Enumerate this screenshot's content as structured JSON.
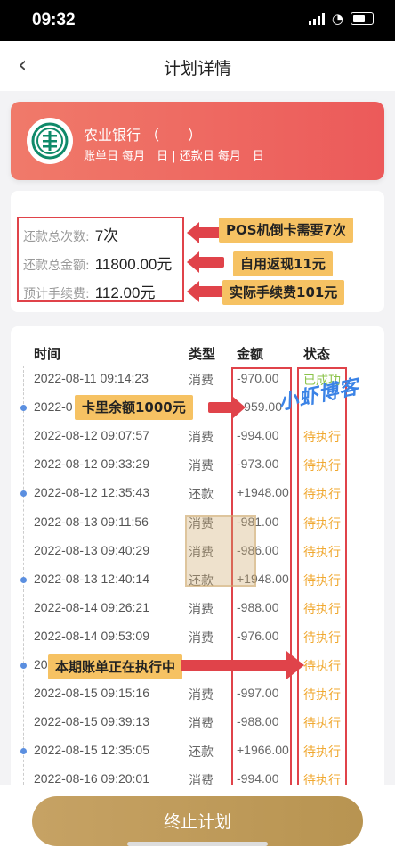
{
  "status_bar": {
    "time": "09:32"
  },
  "nav": {
    "title": "计划详情"
  },
  "bank": {
    "name": "农业银行 （　　）",
    "dates": "账单日 每月　日 | 还款日 每月　日"
  },
  "summary": {
    "total_count_label": "还款总次数:",
    "total_count": "7次",
    "total_amount_label": "还款总金额:",
    "total_amount": "11800.00元",
    "fee_label": "预计手续费:",
    "fee": "112.00元"
  },
  "callouts": {
    "c1": "POS机倒卡需要7次",
    "c2": "自用返现11元",
    "c3": "实际手续费101元",
    "c4": "卡里余额1000元",
    "c5": "本期账单正在执行中"
  },
  "watermark": "小虾博客",
  "list": {
    "headers": {
      "time": "时间",
      "type": "类型",
      "amount": "金额",
      "status": "状态"
    },
    "rows": [
      {
        "time": "2022-08-11 09:14:23",
        "type": "消费",
        "amount": "-970.00",
        "status": "已成功"
      },
      {
        "time": "2022-0",
        "type": "",
        "amount": "+959.00",
        "status": ""
      },
      {
        "time": "2022-08-12 09:07:57",
        "type": "消费",
        "amount": "-994.00",
        "status": "待执行"
      },
      {
        "time": "2022-08-12 09:33:29",
        "type": "消费",
        "amount": "-973.00",
        "status": "待执行"
      },
      {
        "time": "2022-08-12 12:35:43",
        "type": "还款",
        "amount": "+1948.00",
        "status": "待执行"
      },
      {
        "time": "2022-08-13 09:11:56",
        "type": "消费",
        "amount": "-981.00",
        "status": "待执行"
      },
      {
        "time": "2022-08-13 09:40:29",
        "type": "消费",
        "amount": "-986.00",
        "status": "待执行"
      },
      {
        "time": "2022-08-13 12:40:14",
        "type": "还款",
        "amount": "+1948.00",
        "status": "待执行"
      },
      {
        "time": "2022-08-14 09:26:21",
        "type": "消费",
        "amount": "-988.00",
        "status": "待执行"
      },
      {
        "time": "2022-08-14 09:53:09",
        "type": "消费",
        "amount": "-976.00",
        "status": "待执行"
      },
      {
        "time": "20",
        "type": "",
        "amount": "",
        "status": "待执行"
      },
      {
        "time": "2022-08-15 09:15:16",
        "type": "消费",
        "amount": "-997.00",
        "status": "待执行"
      },
      {
        "time": "2022-08-15 09:39:13",
        "type": "消费",
        "amount": "-988.00",
        "status": "待执行"
      },
      {
        "time": "2022-08-15 12:35:05",
        "type": "还款",
        "amount": "+1966.00",
        "status": "待执行"
      },
      {
        "time": "2022-08-16 09:20:01",
        "type": "消费",
        "amount": "-994.00",
        "status": "待执行"
      }
    ]
  },
  "stop_button": "终止计划"
}
